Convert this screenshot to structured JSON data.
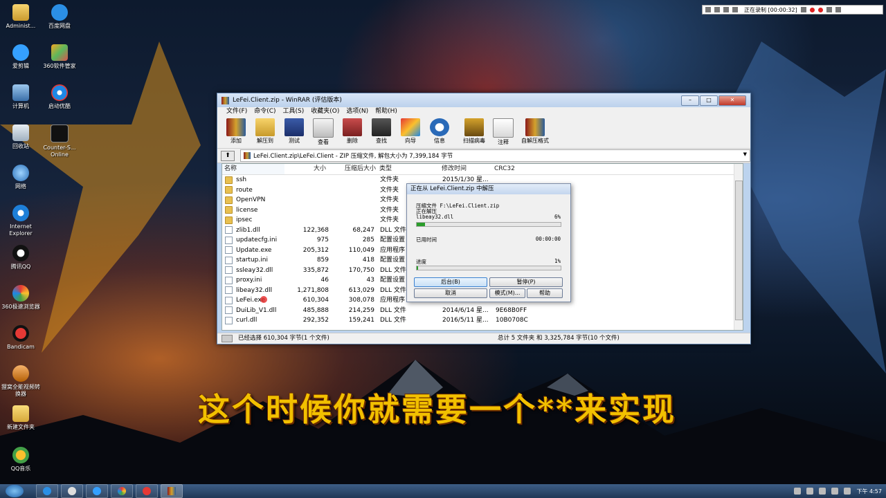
{
  "desktop": {
    "icons": [
      {
        "label": "Administ..."
      },
      {
        "label": "百度网盘"
      },
      {
        "label": "爱剪辑"
      },
      {
        "label": "360软件管家"
      },
      {
        "label": "计算机"
      },
      {
        "label": "启动优酷"
      },
      {
        "label": "回收站"
      },
      {
        "label": "Counter-S... Online"
      },
      {
        "label": "网络"
      },
      {
        "label": "Internet Explorer"
      },
      {
        "label": "腾讯QQ"
      },
      {
        "label": "360极速浏览器"
      },
      {
        "label": "Bandicam"
      },
      {
        "label": "狸窝全能视频转换器"
      },
      {
        "label": "新建文件夹"
      },
      {
        "label": "QQ音乐"
      }
    ]
  },
  "recorder": {
    "status": "正在录制 [00:00:32]"
  },
  "window": {
    "title": "LeFei.Client.zip - WinRAR (评估版本)",
    "menu": [
      "文件(F)",
      "命令(C)",
      "工具(S)",
      "收藏夹(O)",
      "选项(N)",
      "帮助(H)"
    ],
    "toolbar": [
      "添加",
      "解压到",
      "测试",
      "查看",
      "删除",
      "查找",
      "向导",
      "信息",
      "扫描病毒",
      "注释",
      "自解压格式"
    ],
    "address": "LeFei.Client.zip\\LeFei.Client - ZIP 压缩文件, 解包大小为 7,399,184 字节",
    "columns": {
      "name": "名称",
      "size": "大小",
      "packed": "压缩后大小",
      "type": "类型",
      "modified": "修改时间",
      "crc": "CRC32"
    },
    "rows": [
      {
        "name": "ssh",
        "size": "",
        "packed": "",
        "type": "文件夹",
        "modified": "2015/1/30 星...",
        "crc": "",
        "kind": "folder"
      },
      {
        "name": "route",
        "size": "",
        "packed": "",
        "type": "文件夹",
        "modified": "",
        "crc": "",
        "kind": "folder"
      },
      {
        "name": "OpenVPN",
        "size": "",
        "packed": "",
        "type": "文件夹",
        "modified": "",
        "crc": "",
        "kind": "folder"
      },
      {
        "name": "license",
        "size": "",
        "packed": "",
        "type": "文件夹",
        "modified": "",
        "crc": "",
        "kind": "folder"
      },
      {
        "name": "ipsec",
        "size": "",
        "packed": "",
        "type": "文件夹",
        "modified": "",
        "crc": "",
        "kind": "folder"
      },
      {
        "name": "zlib1.dll",
        "size": "122,368",
        "packed": "68,247",
        "type": "DLL 文件",
        "modified": "",
        "crc": "",
        "kind": "file"
      },
      {
        "name": "updatecfg.ini",
        "size": "975",
        "packed": "285",
        "type": "配置设置",
        "modified": "",
        "crc": "",
        "kind": "file"
      },
      {
        "name": "Update.exe",
        "size": "205,312",
        "packed": "110,049",
        "type": "应用程序",
        "modified": "",
        "crc": "",
        "kind": "file"
      },
      {
        "name": "startup.ini",
        "size": "859",
        "packed": "418",
        "type": "配置设置",
        "modified": "",
        "crc": "",
        "kind": "file"
      },
      {
        "name": "ssleay32.dll",
        "size": "335,872",
        "packed": "170,750",
        "type": "DLL 文件",
        "modified": "",
        "crc": "",
        "kind": "file"
      },
      {
        "name": "proxy.ini",
        "size": "46",
        "packed": "43",
        "type": "配置设置",
        "modified": "",
        "crc": "",
        "kind": "file"
      },
      {
        "name": "libeay32.dll",
        "size": "1,271,808",
        "packed": "613,029",
        "type": "DLL 文件",
        "modified": "",
        "crc": "",
        "kind": "file"
      },
      {
        "name": "LeFei.exe",
        "size": "610,304",
        "packed": "308,078",
        "type": "应用程序",
        "modified": "",
        "crc": "",
        "kind": "file"
      },
      {
        "name": "DuiLib_V1.dll",
        "size": "485,888",
        "packed": "214,259",
        "type": "DLL 文件",
        "modified": "2014/6/14 星...",
        "crc": "9E68B0FF",
        "kind": "file"
      },
      {
        "name": "curl.dll",
        "size": "292,352",
        "packed": "159,241",
        "type": "DLL 文件",
        "modified": "2016/5/11 星...",
        "crc": "10B0708C",
        "kind": "file"
      }
    ],
    "status_left": "已经选择 610,304 字节(1 个文件)",
    "status_right": "总计 5 文件夹 和 3,325,784 字节(10 个文件)"
  },
  "dialog": {
    "title": "正在从 LeFei.Client.zip 中解压",
    "archive_line": "压缩文件 F:\\LeFei.Client.zip",
    "action": "正在解压",
    "current_file": "libeay32.dll",
    "file_percent": "6%",
    "file_progress": 0.06,
    "elapsed_label": "已用时间",
    "elapsed": "00:00:00",
    "progress_label": "进度",
    "total_percent": "1%",
    "total_progress": 0.01,
    "buttons": {
      "background": "后台(B)",
      "pause": "暂停(P)",
      "cancel": "取消",
      "mode": "模式(M)...",
      "help": "帮助"
    }
  },
  "subtitle": "这个时候你就需要一个**来实现",
  "taskbar": {
    "clock": "下午 4:57"
  }
}
